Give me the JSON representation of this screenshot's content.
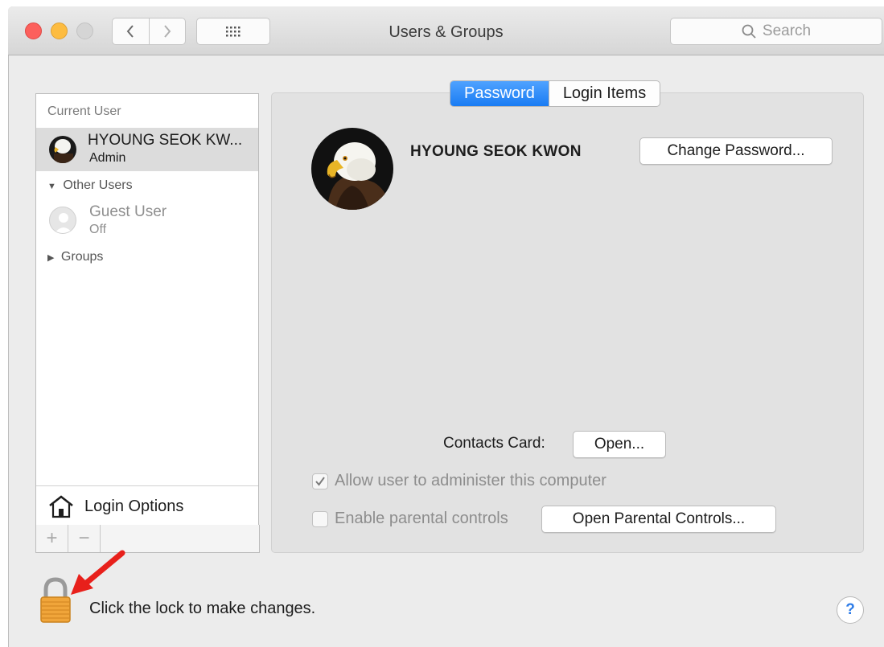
{
  "window": {
    "title": "Users & Groups"
  },
  "search": {
    "placeholder": "Search"
  },
  "sidebar": {
    "current_user_header": "Current User",
    "current_user": {
      "name": "HYOUNG SEOK KW...",
      "role": "Admin"
    },
    "other_users_header": "Other Users",
    "guest_user": {
      "name": "Guest User",
      "status": "Off"
    },
    "groups_header": "Groups",
    "login_options_label": "Login Options",
    "add_button": "+",
    "remove_button": "−"
  },
  "tabs": [
    {
      "label": "Password",
      "active": true
    },
    {
      "label": "Login Items",
      "active": false
    }
  ],
  "user": {
    "full_name": "HYOUNG SEOK KWON"
  },
  "buttons": {
    "change_password": "Change Password...",
    "contacts_open": "Open...",
    "open_parental_controls": "Open Parental Controls..."
  },
  "contacts": {
    "label": "Contacts Card:"
  },
  "options": {
    "allow_admin": {
      "label": "Allow user to administer this computer",
      "checked": true
    },
    "parental": {
      "label": "Enable parental controls",
      "checked": false
    }
  },
  "footer": {
    "lock_text": "Click the lock to make changes.",
    "help": "?"
  },
  "colors": {
    "accent": "#1a7cf3",
    "lock": "#f0a53a",
    "arrow": "#e8201b"
  }
}
